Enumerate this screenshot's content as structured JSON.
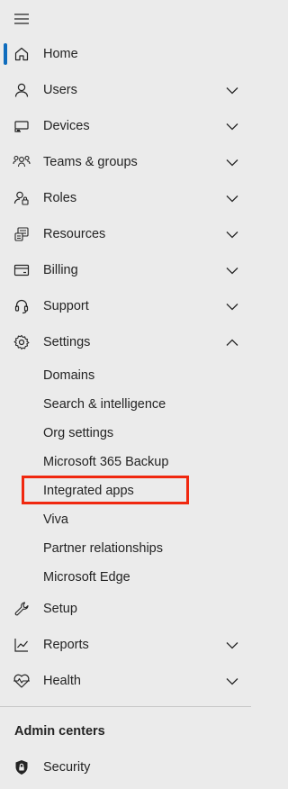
{
  "nav": {
    "items": [
      {
        "label": "Home"
      },
      {
        "label": "Users"
      },
      {
        "label": "Devices"
      },
      {
        "label": "Teams & groups"
      },
      {
        "label": "Roles"
      },
      {
        "label": "Resources"
      },
      {
        "label": "Billing"
      },
      {
        "label": "Support"
      },
      {
        "label": "Settings"
      }
    ],
    "settings_subitems": [
      {
        "label": "Domains"
      },
      {
        "label": "Search & intelligence"
      },
      {
        "label": "Org settings"
      },
      {
        "label": "Microsoft 365 Backup"
      },
      {
        "label": "Integrated apps"
      },
      {
        "label": "Viva"
      },
      {
        "label": "Partner relationships"
      },
      {
        "label": "Microsoft Edge"
      }
    ],
    "after_items": [
      {
        "label": "Setup"
      },
      {
        "label": "Reports"
      },
      {
        "label": "Health"
      }
    ]
  },
  "admin_centers": {
    "title": "Admin centers",
    "items": [
      {
        "label": "Security"
      }
    ]
  },
  "colors": {
    "active_indicator": "#0f6cbd",
    "highlight_box": "#f0280f",
    "background": "#ebebeb"
  },
  "icons": [
    "hamburger-menu-icon",
    "home-icon",
    "person-icon",
    "device-icon",
    "people-team-icon",
    "person-key-icon",
    "resources-icon",
    "billing-card-icon",
    "headset-icon",
    "gear-icon",
    "wrench-icon",
    "chart-line-icon",
    "heart-pulse-icon",
    "shield-icon",
    "chevron-down-icon",
    "chevron-up-icon"
  ]
}
